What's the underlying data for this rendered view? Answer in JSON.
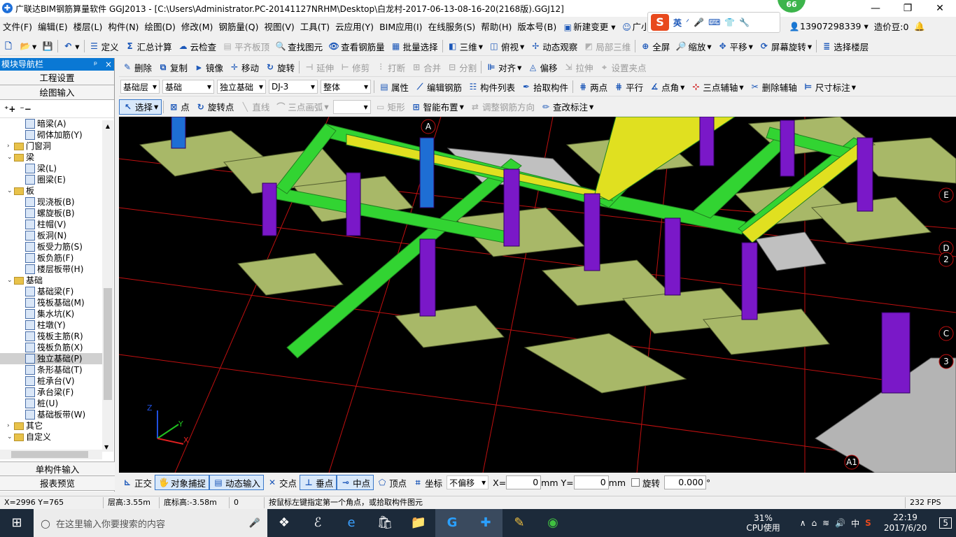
{
  "titlebar": {
    "title": "广联达BIM钢筋算量软件 GGJ2013 - [C:\\Users\\Administrator.PC-20141127NRHM\\Desktop\\白龙村-2017-06-13-08-16-20(2168版).GGJ12]",
    "badge": "66",
    "minimize": "—",
    "restore": "❐",
    "close": "✕"
  },
  "menu": {
    "items": [
      "文件(F)",
      "编辑(E)",
      "楼层(L)",
      "构件(N)",
      "绘图(D)",
      "修改(M)",
      "钢筋量(Q)",
      "视图(V)",
      "工具(T)",
      "云应用(Y)",
      "BIM应用(I)",
      "在线服务(S)",
      "帮助(H)",
      "版本号(B)"
    ],
    "new_change": "新建变更",
    "assistant": "广小二",
    "phone": "13907298339",
    "price_bean": "造价豆:0"
  },
  "ime": {
    "logo": "S",
    "lang": "英"
  },
  "toolbar1": {
    "items": [
      "定义",
      "汇总计算",
      "云检查",
      "平齐板顶",
      "查找图元",
      "查看钢筋量",
      "批量选择",
      "三维",
      "俯视",
      "动态观察",
      "局部三维",
      "全屏",
      "缩放",
      "平移",
      "屏幕旋转",
      "选择楼层"
    ]
  },
  "toolbar2": {
    "items": [
      "删除",
      "复制",
      "镜像",
      "移动",
      "旋转",
      "延伸",
      "修剪",
      "打断",
      "合并",
      "分割",
      "对齐",
      "偏移",
      "拉伸",
      "设置夹点"
    ]
  },
  "toolbar3": {
    "floor": "基础层",
    "category": "基础",
    "type": "独立基础",
    "component": "DJ-3",
    "whole": "整体",
    "items": [
      "属性",
      "编辑钢筋",
      "构件列表",
      "拾取构件",
      "两点",
      "平行",
      "点角",
      "三点辅轴",
      "删除辅轴",
      "尺寸标注"
    ]
  },
  "toolbar4": {
    "items": [
      "选择",
      "点",
      "旋转点",
      "直线",
      "三点画弧",
      "矩形",
      "智能布置",
      "调整钢筋方向",
      "查改标注"
    ]
  },
  "navpanel": {
    "header": "模块导航栏",
    "pin": "ᵖ",
    "close": "×",
    "btn_project": "工程设置",
    "btn_drawing": "绘图输入",
    "tree": [
      {
        "label": "暗梁(A)",
        "level": 2,
        "kind": "leaf"
      },
      {
        "label": "砌体加筋(Y)",
        "level": 2,
        "kind": "leaf"
      },
      {
        "label": "门窗洞",
        "level": 1,
        "kind": "folder",
        "exp": "›"
      },
      {
        "label": "梁",
        "level": 1,
        "kind": "folder",
        "exp": "⌄"
      },
      {
        "label": "梁(L)",
        "level": 2,
        "kind": "leaf"
      },
      {
        "label": "圈梁(E)",
        "level": 2,
        "kind": "leaf"
      },
      {
        "label": "板",
        "level": 1,
        "kind": "folder",
        "exp": "⌄"
      },
      {
        "label": "现浇板(B)",
        "level": 2,
        "kind": "leaf"
      },
      {
        "label": "螺旋板(B)",
        "level": 2,
        "kind": "leaf"
      },
      {
        "label": "柱帽(V)",
        "level": 2,
        "kind": "leaf"
      },
      {
        "label": "板洞(N)",
        "level": 2,
        "kind": "leaf"
      },
      {
        "label": "板受力筋(S)",
        "level": 2,
        "kind": "leaf"
      },
      {
        "label": "板负筋(F)",
        "level": 2,
        "kind": "leaf"
      },
      {
        "label": "楼层板带(H)",
        "level": 2,
        "kind": "leaf"
      },
      {
        "label": "基础",
        "level": 1,
        "kind": "folder",
        "exp": "⌄"
      },
      {
        "label": "基础梁(F)",
        "level": 2,
        "kind": "leaf"
      },
      {
        "label": "筏板基础(M)",
        "level": 2,
        "kind": "leaf"
      },
      {
        "label": "集水坑(K)",
        "level": 2,
        "kind": "leaf"
      },
      {
        "label": "柱墩(Y)",
        "level": 2,
        "kind": "leaf"
      },
      {
        "label": "筏板主筋(R)",
        "level": 2,
        "kind": "leaf"
      },
      {
        "label": "筏板负筋(X)",
        "level": 2,
        "kind": "leaf"
      },
      {
        "label": "独立基础(P)",
        "level": 2,
        "kind": "leaf",
        "selected": true
      },
      {
        "label": "条形基础(T)",
        "level": 2,
        "kind": "leaf"
      },
      {
        "label": "桩承台(V)",
        "level": 2,
        "kind": "leaf"
      },
      {
        "label": "承台梁(F)",
        "level": 2,
        "kind": "leaf"
      },
      {
        "label": "桩(U)",
        "level": 2,
        "kind": "leaf"
      },
      {
        "label": "基础板带(W)",
        "level": 2,
        "kind": "leaf"
      },
      {
        "label": "其它",
        "level": 1,
        "kind": "folder",
        "exp": "›"
      },
      {
        "label": "自定义",
        "level": 1,
        "kind": "folder",
        "exp": "⌄"
      }
    ],
    "btn_single": "单构件输入",
    "btn_report": "报表预览"
  },
  "canvas": {
    "axis_labels": [
      "A",
      "E",
      "D",
      "2",
      "C",
      "3",
      "A1",
      "3"
    ],
    "axes": {
      "x": "X",
      "y": "Y",
      "z": "Z"
    }
  },
  "bottomtb": {
    "items": [
      "正交",
      "对象捕捉",
      "动态输入",
      "交点",
      "垂点",
      "中点",
      "顶点",
      "坐标"
    ],
    "offset": "不偏移",
    "x_label": "X=",
    "x_value": "0",
    "y_label": "Y=",
    "y_value": "0",
    "unit": "mm",
    "rotate": "旋转",
    "rotate_value": "0.000",
    "degree": "°"
  },
  "statusbar": {
    "coords": "X=2996 Y=765",
    "floor_height": "层高:3.55m",
    "bottom_height": "底标高:-3.58m",
    "zero": "0",
    "hint": "按鼠标左键指定第一个角点，或拾取构件图元",
    "fps": "232 FPS"
  },
  "taskbar": {
    "search_placeholder": "在这里输入你要搜索的内容",
    "cpu_percent": "31%",
    "cpu_label": "CPU使用",
    "lang": "中",
    "time": "22:19",
    "date": "2017/6/20",
    "notif": "5"
  }
}
